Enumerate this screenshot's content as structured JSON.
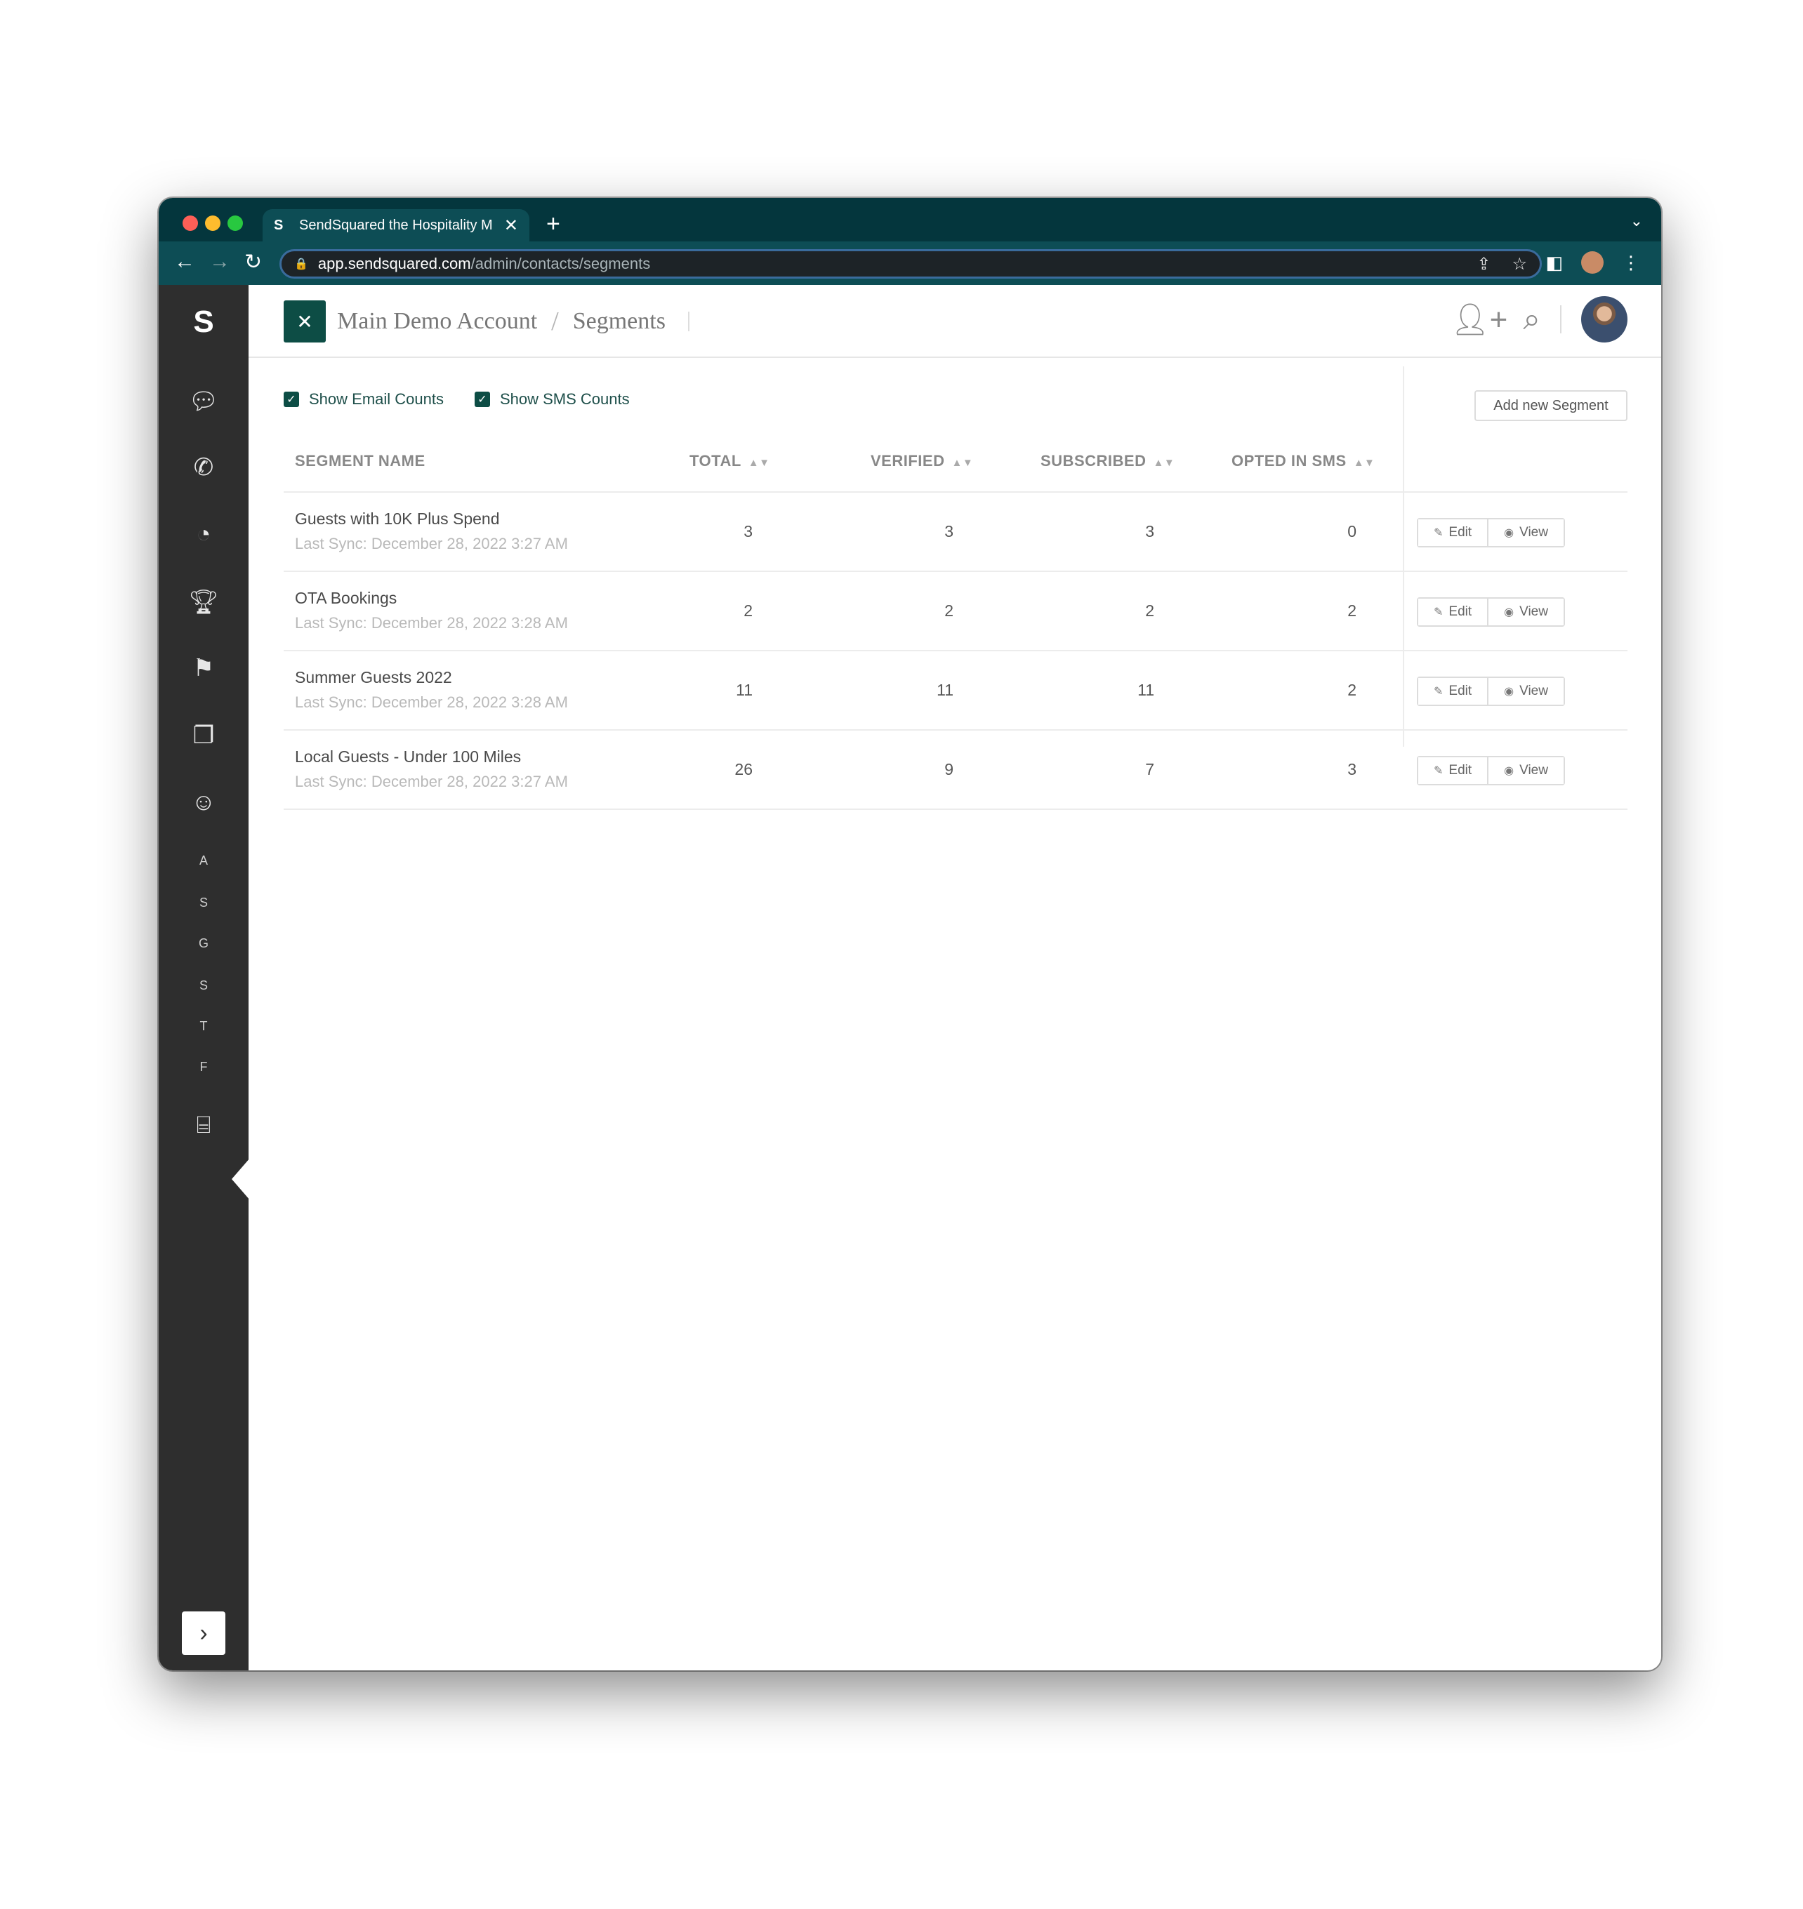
{
  "browser": {
    "tab_title": "SendSquared the Hospitality M",
    "tab_favicon": "S",
    "url_domain": "app.sendsquared.com",
    "url_path": "/admin/contacts/segments"
  },
  "sidebar": {
    "logo": "S",
    "letters": [
      "A",
      "S",
      "G",
      "S",
      "T",
      "F"
    ]
  },
  "header": {
    "account": "Main Demo Account",
    "separator": "/",
    "page": "Segments"
  },
  "controls": {
    "show_email_label": "Show Email Counts",
    "show_sms_label": "Show SMS Counts",
    "add_button": "Add new Segment"
  },
  "table": {
    "columns": {
      "name": "SEGMENT NAME",
      "total": "TOTAL",
      "verified": "VERIFIED",
      "subscribed": "SUBSCRIBED",
      "opted_in_sms": "OPTED IN SMS"
    },
    "edit_label": "Edit",
    "view_label": "View",
    "rows": [
      {
        "name": "Guests with 10K Plus Spend",
        "sync": "Last Sync: December 28, 2022 3:27 AM",
        "total": "3",
        "verified": "3",
        "subscribed": "3",
        "sms": "0"
      },
      {
        "name": "OTA Bookings",
        "sync": "Last Sync: December 28, 2022 3:28 AM",
        "total": "2",
        "verified": "2",
        "subscribed": "2",
        "sms": "2"
      },
      {
        "name": "Summer Guests 2022",
        "sync": "Last Sync: December 28, 2022 3:28 AM",
        "total": "11",
        "verified": "11",
        "subscribed": "11",
        "sms": "2"
      },
      {
        "name": "Local Guests - Under 100 Miles",
        "sync": "Last Sync: December 28, 2022 3:27 AM",
        "total": "26",
        "verified": "9",
        "subscribed": "7",
        "sms": "3"
      }
    ]
  },
  "colors": {
    "brand_dark": "#04363d",
    "accent": "#0d4d45",
    "sidebar_bg": "#2e2e2e"
  }
}
